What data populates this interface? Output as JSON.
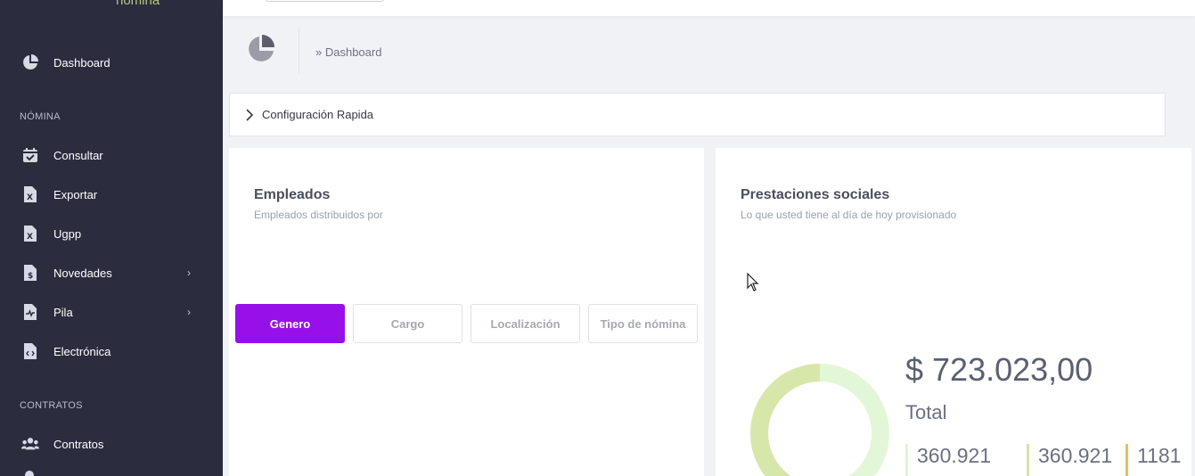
{
  "brand": {
    "text": "nómina"
  },
  "sidebar": {
    "items": [
      {
        "label": "Dashboard",
        "icon": "pie-chart-icon"
      },
      {
        "label": "Consultar",
        "icon": "calendar-check-icon"
      },
      {
        "label": "Exportar",
        "icon": "excel-file-icon"
      },
      {
        "label": "Ugpp",
        "icon": "excel-file-icon"
      },
      {
        "label": "Novedades",
        "icon": "dollar-file-icon",
        "chevron": "›"
      },
      {
        "label": "Pila",
        "icon": "pulse-file-icon",
        "chevron": "›"
      },
      {
        "label": "Electrónica",
        "icon": "code-file-icon"
      },
      {
        "label": "Contratos",
        "icon": "users-icon"
      }
    ],
    "sections": {
      "nomina": "NÓMINA",
      "contratos": "CONTRATOS"
    }
  },
  "breadcrumb": {
    "text": "» Dashboard"
  },
  "accordion": {
    "label": "Configuración Rapida"
  },
  "empleados": {
    "title": "Empleados",
    "subtitle": "Empleados distribuidos por",
    "tabs": [
      "Genero",
      "Cargo",
      "Localización",
      "Tipo de nómina"
    ],
    "active_tab": "Genero"
  },
  "prestaciones": {
    "title": "Prestaciones sociales",
    "subtitle": "Lo que usted tiene al día de hoy provisionado",
    "total_amount": "$ 723.023,00",
    "total_label": "Total",
    "stats": [
      {
        "value": "360.921",
        "color": "#e2f3d6"
      },
      {
        "value": "360.921",
        "color": "#d3e4a8"
      },
      {
        "value": "1181",
        "color": "#d8c46a"
      }
    ],
    "donut_colors": {
      "light": "#e2f7d8",
      "dark": "#d7e7a9"
    }
  },
  "colors": {
    "sidebar_bg": "#2b2d3e",
    "accent": "#9610ea",
    "page_bg": "#f1f2f6"
  }
}
